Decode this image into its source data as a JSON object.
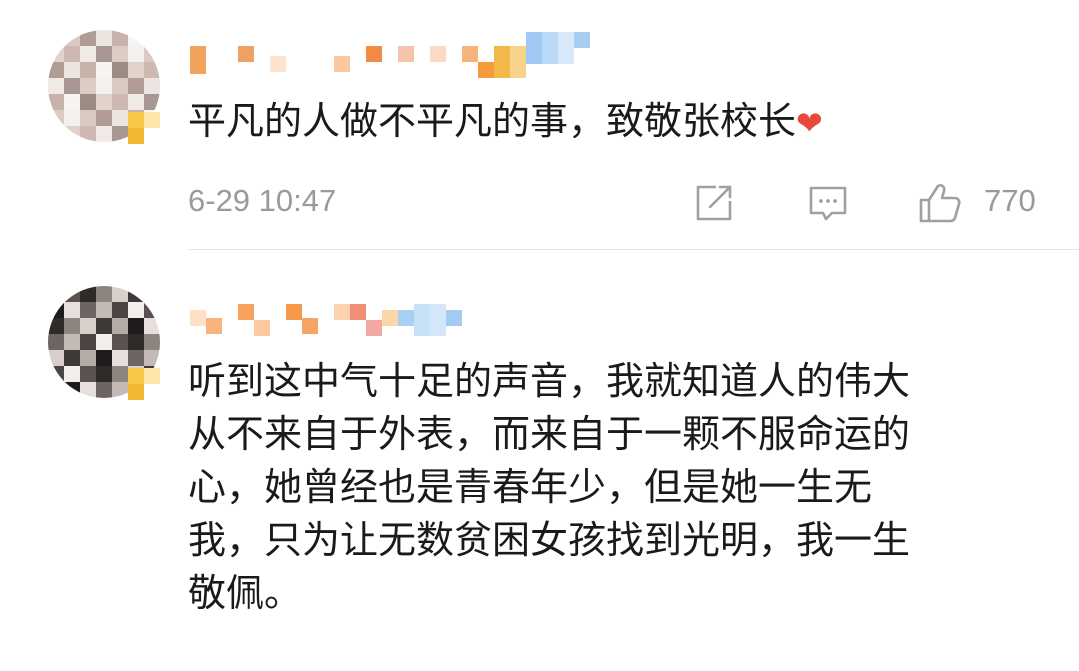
{
  "comments": [
    {
      "text": "平凡的人做不平凡的事，致敬张校长",
      "emoji": "❤",
      "time": "6-29 10:47",
      "likes": "770",
      "icons": [
        "share-icon",
        "comment-icon",
        "like-icon"
      ]
    },
    {
      "text": "听到这中气十足的声音，我就知道人的伟大\n从不来自于外表，而来自于一颗不服命运的\n心，她曾经也是青春年少，但是她一生无\n我，只为让无数贫困女孩找到光明，我一生\n敬佩。"
    }
  ],
  "colors": {
    "heart": "#e8473a",
    "meta_text": "#9a9a9a",
    "divider": "#e5e5e5"
  }
}
